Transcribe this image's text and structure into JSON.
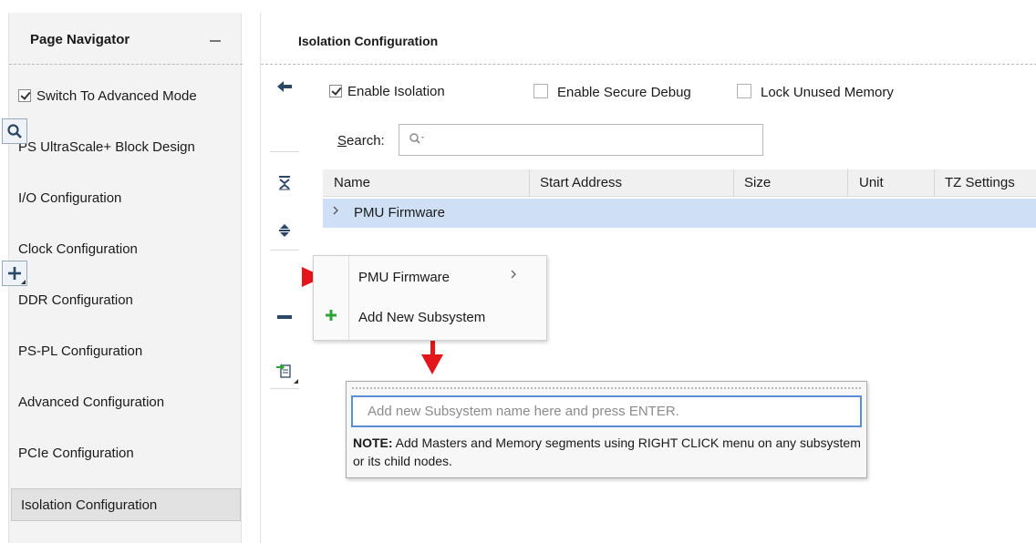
{
  "navigator": {
    "title": "Page Navigator",
    "advanced_mode": {
      "label": "Switch To Advanced Mode",
      "checked": true
    },
    "items": [
      {
        "label": "PS UltraScale+ Block Design"
      },
      {
        "label": "I/O Configuration"
      },
      {
        "label": "Clock Configuration"
      },
      {
        "label": "DDR Configuration"
      },
      {
        "label": "PS-PL Configuration"
      },
      {
        "label": "Advanced Configuration"
      },
      {
        "label": "PCIe Configuration"
      },
      {
        "label": "Isolation Configuration",
        "active": true
      }
    ]
  },
  "main": {
    "title": "Isolation Configuration",
    "options": [
      {
        "label": "Enable Isolation",
        "checked": true
      },
      {
        "label": "Enable Secure Debug",
        "checked": false
      },
      {
        "label": "Lock Unused Memory",
        "checked": false
      }
    ],
    "search": {
      "label": "Search:"
    },
    "table": {
      "columns": [
        "Name",
        "Start Address",
        "Size",
        "Unit",
        "TZ Settings"
      ],
      "rows": [
        {
          "name": "PMU Firmware"
        }
      ]
    }
  },
  "toolbar": {
    "icons": [
      "back-arrow-icon",
      "search-icon",
      "collapse-all-icon",
      "expand-all-icon",
      "add-icon",
      "remove-icon",
      "import-icon"
    ]
  },
  "context_menu": {
    "items": [
      {
        "label": "PMU Firmware",
        "has_submenu": true
      },
      {
        "label": "Add New Subsystem"
      }
    ]
  },
  "popup": {
    "placeholder": "Add new Subsystem name here and press ENTER.",
    "note_label": "NOTE:",
    "note_text": " Add Masters and Memory segments using RIGHT CLICK menu on any subsystem or its child nodes."
  },
  "colors": {
    "selected_row": "#cfe0f6",
    "arrow_red": "#e3161b",
    "add_green": "#2fa336",
    "input_focus": "#5a8fd8"
  }
}
